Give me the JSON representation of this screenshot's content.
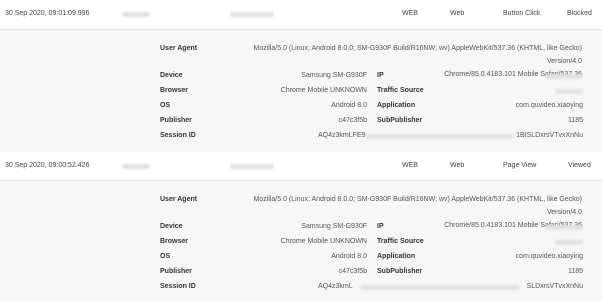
{
  "labels": {
    "user_agent": "User Agent",
    "device": "Device",
    "ip": "IP",
    "browser": "Browser",
    "traffic_source": "Traffic Source",
    "os": "OS",
    "application": "Application",
    "publisher": "Publisher",
    "subpublisher": "SubPublisher",
    "session_id": "Session ID"
  },
  "events": [
    {
      "timestamp": "30 Sep 2020, 09:01:09.996",
      "channel": "WEB",
      "platform": "Web",
      "event_type": "Button Click",
      "status": "Blocked",
      "user_agent_line1": "Mozilla/5.0 (Linux; Android 8.0.0; SM-G930F Build/R16NW; wv) AppleWebKit/537.36 (KHTML, like Gecko) Version/4.0",
      "user_agent_line2": "Chrome/85.0.4183.101 Mobile Safari/537.36",
      "device": "Samsung SM-G930F",
      "browser": "Chrome Mobile UNKNOWN",
      "os": "Android 8.0",
      "application": "com.quvideo.xiaoying",
      "publisher": "c47c3f5b",
      "subpublisher": "1185",
      "session_prefix": "AQ4z3kmLFE9",
      "session_suffix": "1BISLDxrsVTvxXnNu"
    },
    {
      "timestamp": "30 Sep 2020, 09:00:52.426",
      "channel": "WEB",
      "platform": "Web",
      "event_type": "Page View",
      "status": "Viewed",
      "user_agent_line1": "Mozilla/5.0 (Linux; Android 8.0.0; SM-G930F Build/R16NW; wv) AppleWebKit/537.36 (KHTML, like Gecko) Version/4.0",
      "user_agent_line2": "Chrome/85.0.4183.101 Mobile Safari/537.36",
      "device": "Samsung SM-G930F",
      "browser": "Chrome Mobile UNKNOWN",
      "os": "Android 8.0",
      "application": "com.quvideo.xiaoying",
      "publisher": "c47c3f5b",
      "subpublisher": "1185",
      "session_prefix": "AQ4z3kmL",
      "session_suffix": "SLDxrsVTvxXnNu"
    }
  ],
  "colors": {
    "blocked": "#e53935",
    "viewed": "#9e9e9e"
  }
}
